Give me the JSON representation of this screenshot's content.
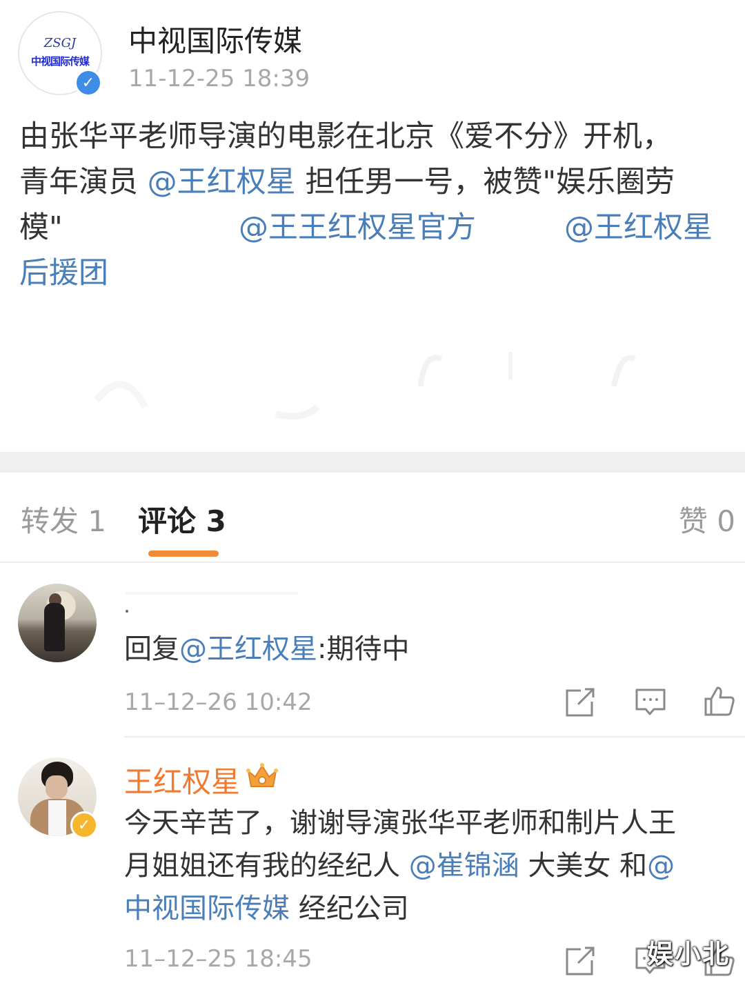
{
  "post": {
    "author": "中视国际传媒",
    "time": "11-12-25 18:39",
    "avatar_logo_script": "ZSGJ",
    "avatar_logo_text": "中视国际传媒",
    "verified_icon": "verified-blue-v",
    "body_lines": [
      [
        {
          "t": "由张华平老师导演的电影在北京《爱不分》开机，",
          "m": false
        }
      ],
      [
        {
          "t": "青年演员 ",
          "m": false
        },
        {
          "t": "@王红权星",
          "m": true
        },
        {
          "t": " 担任男一号，被赞\"娱乐圈劳",
          "m": false
        }
      ],
      [
        {
          "t": "模\"",
          "m": false
        },
        {
          "t": "@王王红权星官方",
          "m": true
        },
        {
          "t": "@王红权星",
          "m": true
        }
      ],
      [
        {
          "t": "后援团",
          "m": true
        }
      ]
    ]
  },
  "tabs": {
    "repost": "转发 1",
    "comment": "评论 3",
    "like": "赞 0"
  },
  "comments": [
    {
      "text_prefix": "回复",
      "mention": "@王红权星",
      "text_suffix": ":期待中",
      "time": "11–12–26 10:42"
    },
    {
      "name": "王红权星",
      "badge_icon": "crown-icon",
      "verified_icon": "verified-gold-v",
      "lines": [
        [
          {
            "t": "今天辛苦了，谢谢导演张华平老师和制片人王",
            "m": false
          }
        ],
        [
          {
            "t": "月姐姐还有我的经纪人 ",
            "m": false
          },
          {
            "t": "@崔锦涵",
            "m": true
          },
          {
            "t": " 大美女 和",
            "m": false
          },
          {
            "t": "@",
            "m": true
          }
        ],
        [
          {
            "t": "中视国际传媒",
            "m": true
          },
          {
            "t": " 经纪公司",
            "m": false
          }
        ]
      ],
      "time": "11–12–25 18:45"
    }
  ],
  "actions": [
    "share-icon",
    "comment-icon",
    "like-icon"
  ],
  "watermark": "娱小北",
  "colors": {
    "mention": "#4a7eb8",
    "accent": "#f08a36",
    "name_highlight": "#f07a30",
    "verified_blue": "#3d8ce6",
    "verified_gold": "#f5b52c"
  }
}
